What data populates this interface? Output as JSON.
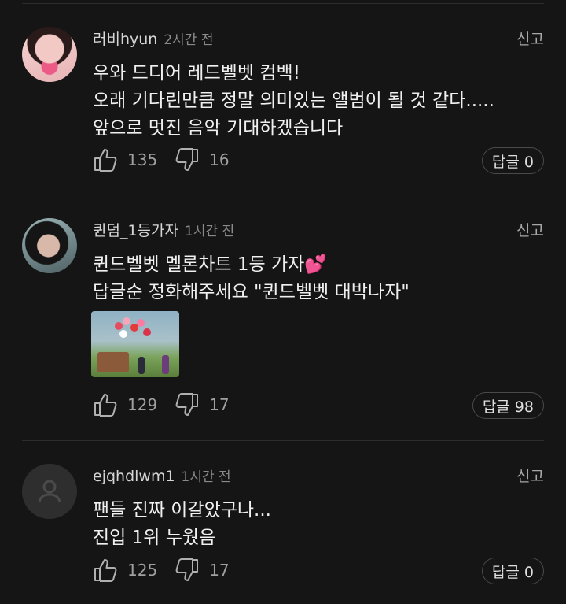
{
  "comments": [
    {
      "username": "러비hyun",
      "time": "2시간 전",
      "report": "신고",
      "lines": [
        "우와 드디어 레드벨벳 컴백!",
        "오래 기다린만큼 정말 의미있는 앨범이 될 것 같다.....",
        "앞으로 멋진 음악 기대하겠습니다"
      ],
      "likes": "135",
      "dislikes": "16",
      "reply": "답글 0"
    },
    {
      "username": "퀸덤_1등가자",
      "time": "1시간 전",
      "report": "신고",
      "lines": [
        "퀸드벨벳 멜론차트 1등 가자💕",
        "답글순 정화해주세요 \"퀸드벨벳 대박나자\""
      ],
      "likes": "129",
      "dislikes": "17",
      "reply": "답글 98",
      "has_image": true
    },
    {
      "username": "ejqhdlwm1",
      "time": "1시간 전",
      "report": "신고",
      "lines": [
        "팬들 진짜 이갈았구나...",
        "진입 1위 누웠음"
      ],
      "likes": "125",
      "dislikes": "17",
      "reply": "답글 0"
    }
  ],
  "icons": {
    "like": "thumbs-up-icon",
    "dislike": "thumbs-down-icon",
    "default_avatar": "person-icon"
  },
  "colors": {
    "background": "#151515",
    "text": "#f0f0f0",
    "muted": "#8a8a8a"
  }
}
